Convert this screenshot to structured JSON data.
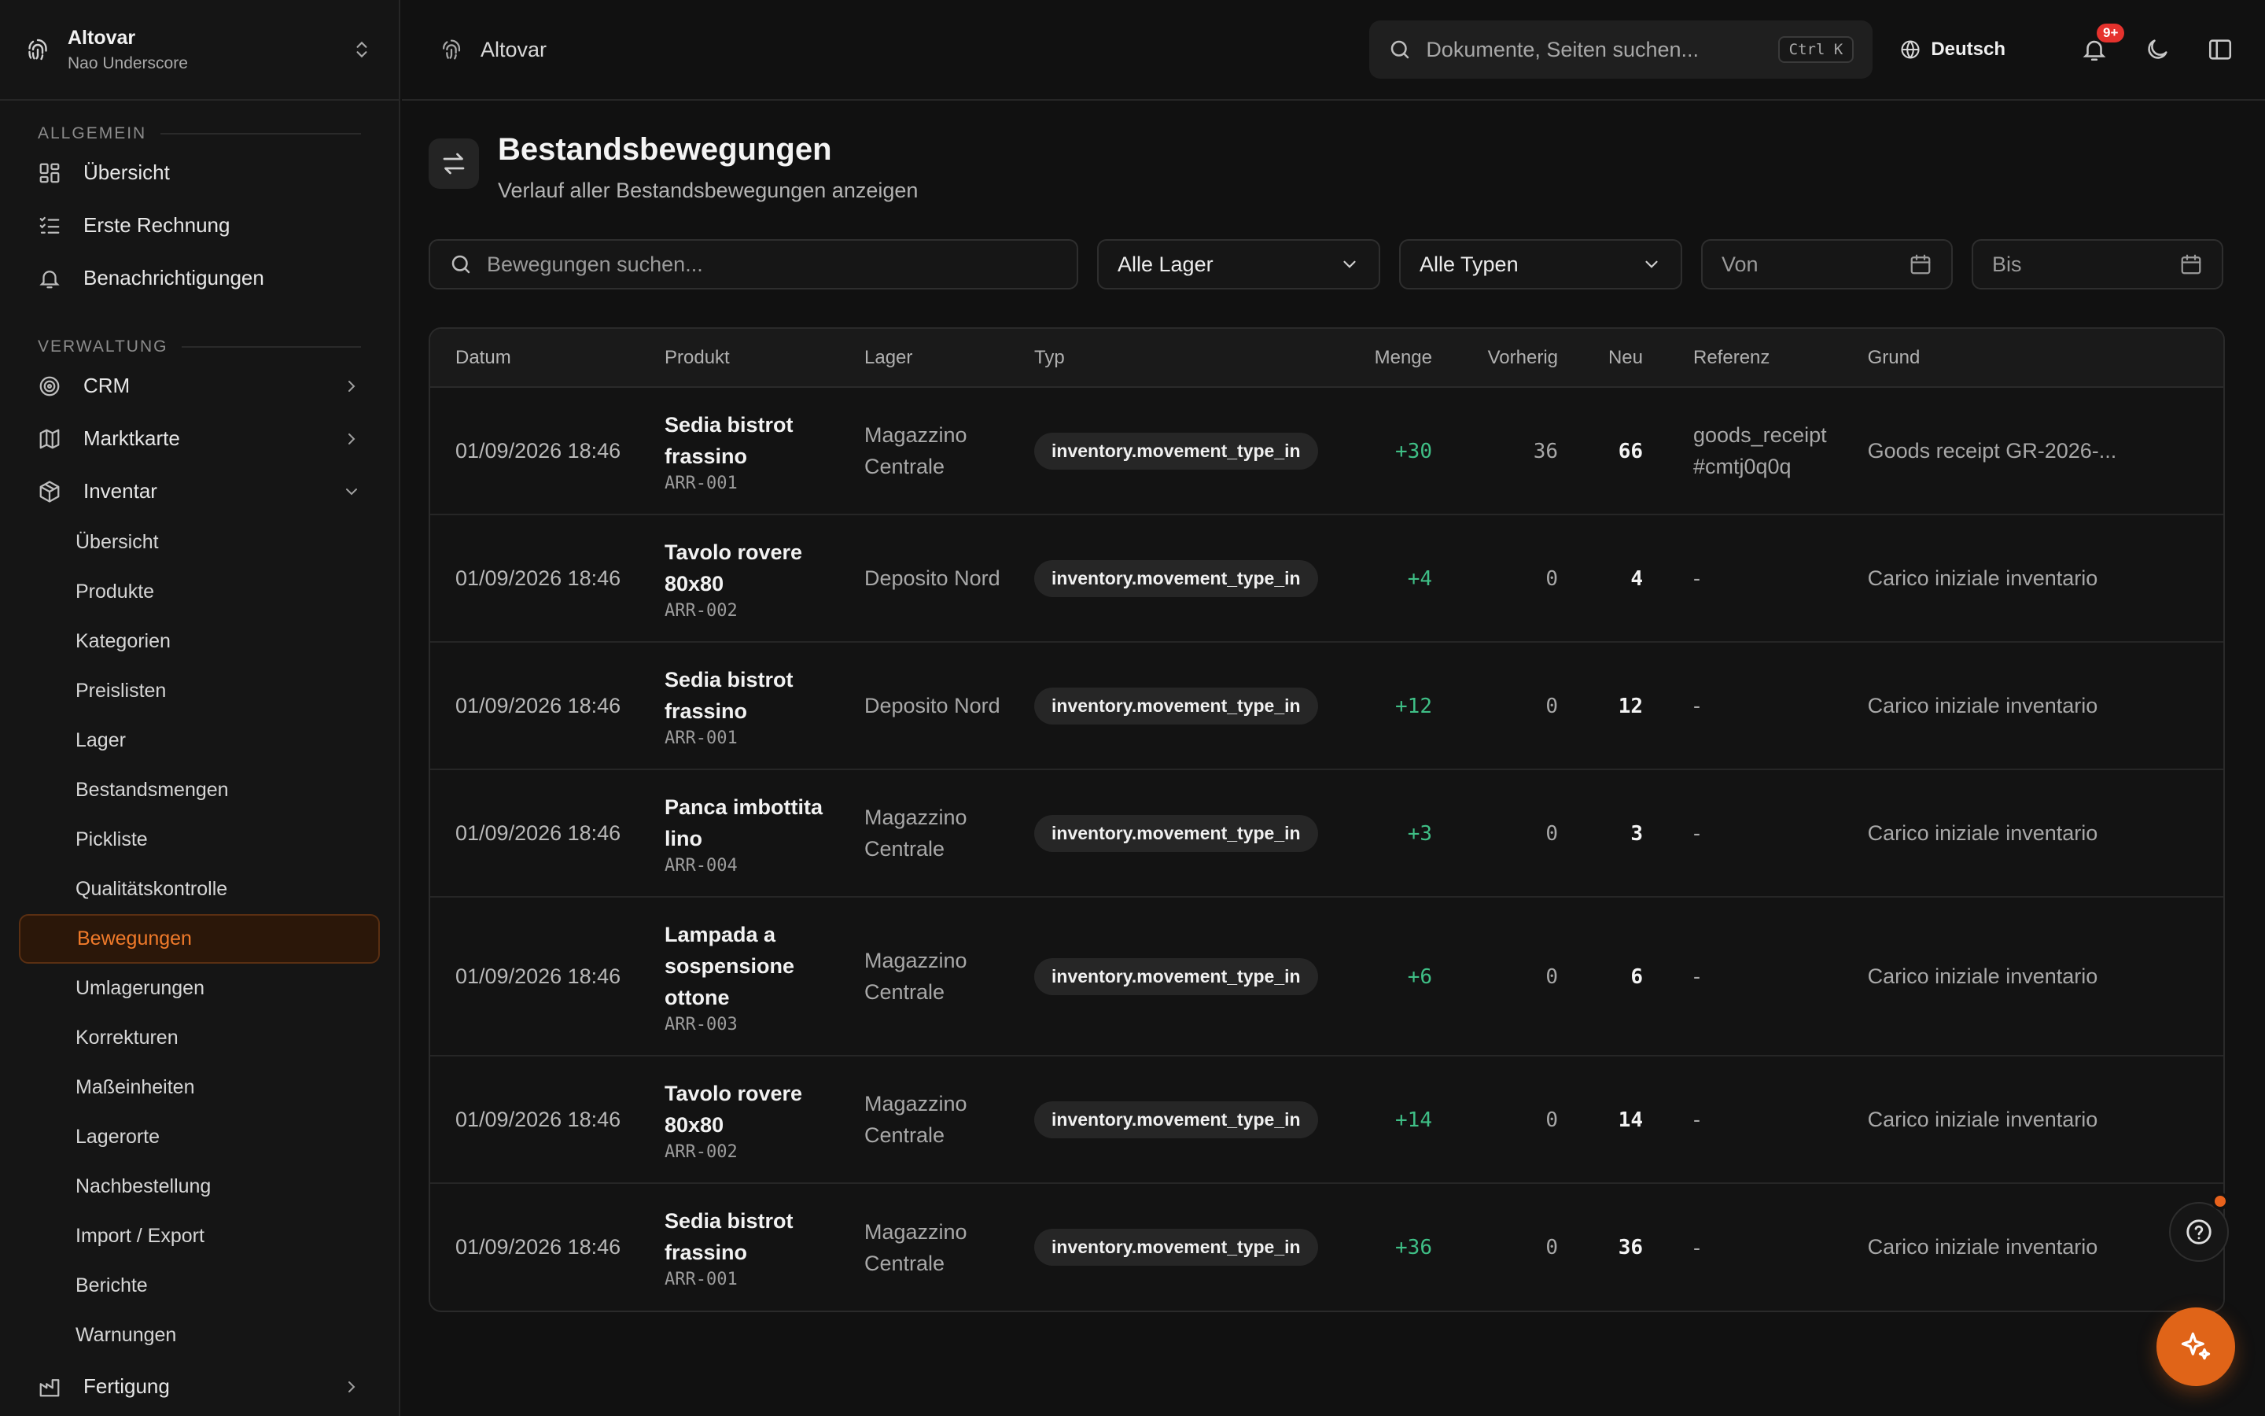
{
  "org": {
    "name": "Altovar",
    "user": "Nao Underscore"
  },
  "sidebar": {
    "section_general": "ALLGEMEIN",
    "general_items": [
      {
        "label": "Übersicht",
        "icon": "dashboard-icon"
      },
      {
        "label": "Erste Rechnung",
        "icon": "checklist-icon"
      },
      {
        "label": "Benachrichtigungen",
        "icon": "bell-icon"
      }
    ],
    "section_admin": "VERWALTUNG",
    "admin_items": [
      {
        "label": "CRM",
        "icon": "target-icon"
      },
      {
        "label": "Marktkarte",
        "icon": "map-icon"
      },
      {
        "label": "Inventar",
        "icon": "package-icon"
      }
    ],
    "inventory_sub": [
      "Übersicht",
      "Produkte",
      "Kategorien",
      "Preislisten",
      "Lager",
      "Bestandsmengen",
      "Pickliste",
      "Qualitätskontrolle",
      "Bewegungen",
      "Umlagerungen",
      "Korrekturen",
      "Maßeinheiten",
      "Lagerorte",
      "Nachbestellung",
      "Import / Export",
      "Berichte",
      "Warnungen"
    ],
    "active_sub": "Bewegungen",
    "bottom_item": "Fertigung"
  },
  "topbar": {
    "app_name": "Altovar",
    "search_placeholder": "Dokumente, Seiten suchen...",
    "shortcut": "Ctrl K",
    "language": "Deutsch",
    "notification_badge": "9+"
  },
  "page": {
    "title": "Bestandsbewegungen",
    "description": "Verlauf aller Bestandsbewegungen anzeigen"
  },
  "filters": {
    "search_placeholder": "Bewegungen suchen...",
    "warehouse": "Alle Lager",
    "type": "Alle Typen",
    "from": "Von",
    "to": "Bis"
  },
  "table": {
    "columns": [
      "Datum",
      "Produkt",
      "Lager",
      "Typ",
      "Menge",
      "Vorherig",
      "Neu",
      "Referenz",
      "Grund"
    ],
    "rows": [
      {
        "date": "01/09/2026 18:46",
        "product": "Sedia bistrot frassino",
        "sku": "ARR-001",
        "warehouse": "Magazzino Centrale",
        "type": "inventory.movement_type_in",
        "qty": "+30",
        "prev": "36",
        "new": "66",
        "ref": "goods_receipt #cmtj0q0q",
        "reason": "Goods receipt GR-2026-..."
      },
      {
        "date": "01/09/2026 18:46",
        "product": "Tavolo rovere 80x80",
        "sku": "ARR-002",
        "warehouse": "Deposito Nord",
        "type": "inventory.movement_type_in",
        "qty": "+4",
        "prev": "0",
        "new": "4",
        "ref": "-",
        "reason": "Carico iniziale inventario"
      },
      {
        "date": "01/09/2026 18:46",
        "product": "Sedia bistrot frassino",
        "sku": "ARR-001",
        "warehouse": "Deposito Nord",
        "type": "inventory.movement_type_in",
        "qty": "+12",
        "prev": "0",
        "new": "12",
        "ref": "-",
        "reason": "Carico iniziale inventario"
      },
      {
        "date": "01/09/2026 18:46",
        "product": "Panca imbottita lino",
        "sku": "ARR-004",
        "warehouse": "Magazzino Centrale",
        "type": "inventory.movement_type_in",
        "qty": "+3",
        "prev": "0",
        "new": "3",
        "ref": "-",
        "reason": "Carico iniziale inventario"
      },
      {
        "date": "01/09/2026 18:46",
        "product": "Lampada a sospensione ottone",
        "sku": "ARR-003",
        "warehouse": "Magazzino Centrale",
        "type": "inventory.movement_type_in",
        "qty": "+6",
        "prev": "0",
        "new": "6",
        "ref": "-",
        "reason": "Carico iniziale inventario"
      },
      {
        "date": "01/09/2026 18:46",
        "product": "Tavolo rovere 80x80",
        "sku": "ARR-002",
        "warehouse": "Magazzino Centrale",
        "type": "inventory.movement_type_in",
        "qty": "+14",
        "prev": "0",
        "new": "14",
        "ref": "-",
        "reason": "Carico iniziale inventario"
      },
      {
        "date": "01/09/2026 18:46",
        "product": "Sedia bistrot frassino",
        "sku": "ARR-001",
        "warehouse": "Magazzino Centrale",
        "type": "inventory.movement_type_in",
        "qty": "+36",
        "prev": "0",
        "new": "36",
        "ref": "-",
        "reason": "Carico iniziale inventario"
      }
    ]
  },
  "colors": {
    "accent": "#e06418",
    "positive": "#3fbf86",
    "badge": "#e5322d"
  }
}
